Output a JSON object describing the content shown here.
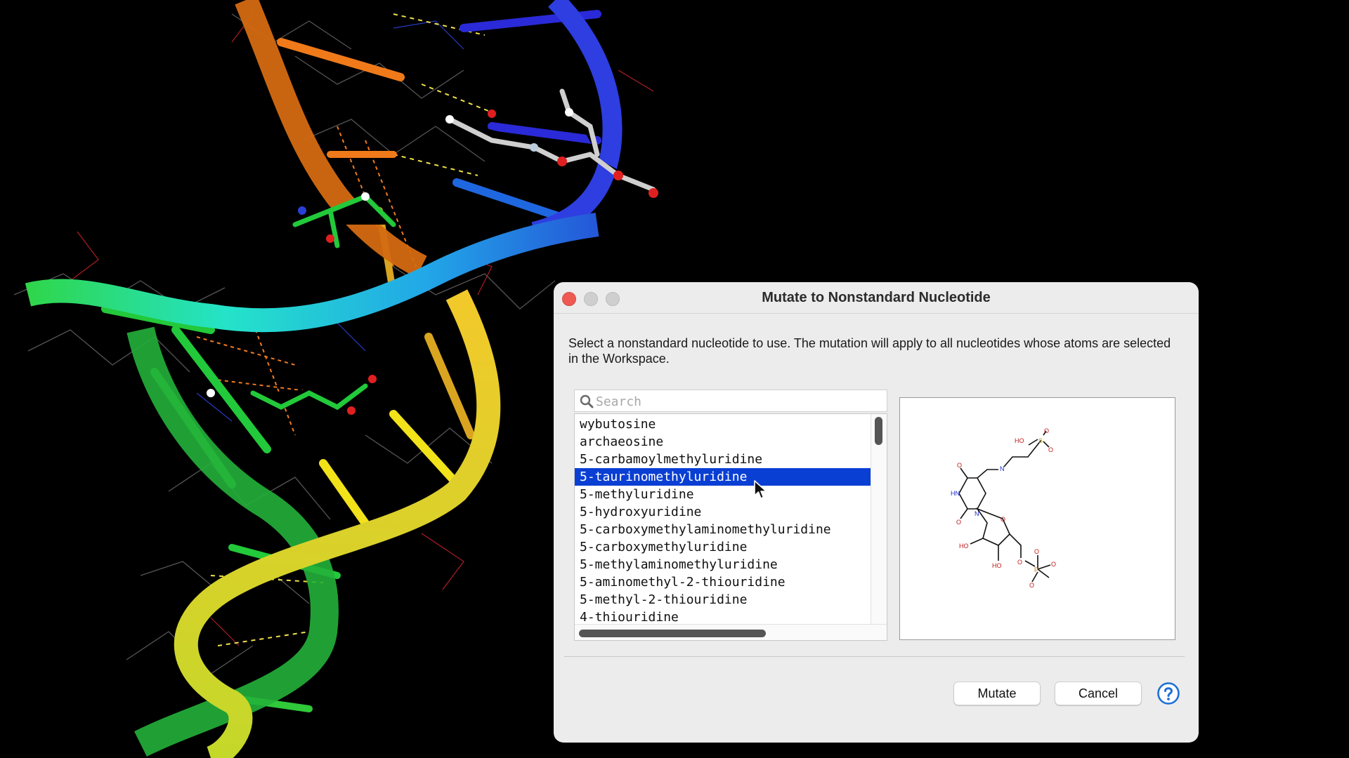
{
  "dialog": {
    "title": "Mutate to Nonstandard Nucleotide",
    "description": "Select a nonstandard nucleotide to use. The mutation will apply to all nucleotides whose atoms are selected in the Workspace.",
    "search": {
      "placeholder": "Search",
      "value": ""
    },
    "list": {
      "selected_index": 3,
      "items": [
        "wybutosine",
        "archaeosine",
        "5-carbamoylmethyluridine",
        "5-taurinomethyluridine",
        "5-methyluridine",
        "5-hydroxyuridine",
        "5-carboxymethylaminomethyluridine",
        "5-carboxymethyluridine",
        "5-methylaminomethyluridine",
        "5-aminomethyl-2-thiouridine",
        "5-methyl-2-thiouridine",
        "4-thiouridine"
      ]
    },
    "preview": {
      "atom_labels": [
        "HO",
        "S",
        "O",
        "O",
        "N",
        "O",
        "HN",
        "N",
        "O",
        "O",
        "HO",
        "HO",
        "O",
        "P",
        "O",
        "O",
        "O"
      ]
    },
    "buttons": {
      "mutate": "Mutate",
      "cancel": "Cancel"
    }
  },
  "colors": {
    "selection": "#0a3fd4",
    "dialog_bg": "#ececec",
    "help_icon": "#1d6fd6",
    "close_button": "#ee5a52"
  },
  "icons": [
    "close-icon",
    "search-icon",
    "help-icon",
    "mouse-cursor-icon"
  ]
}
